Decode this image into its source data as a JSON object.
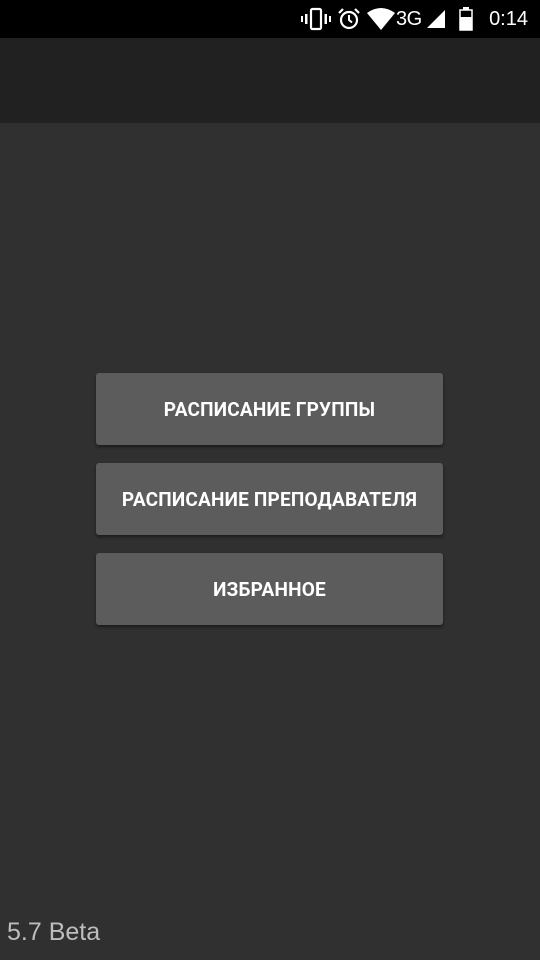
{
  "status_bar": {
    "time": "0:14",
    "network_type": "3G",
    "icons": [
      "vibrate-icon",
      "alarm-icon",
      "wifi-icon",
      "cell-signal-icon",
      "battery-icon"
    ]
  },
  "menu": {
    "group_schedule_label": "РАСПИСАНИЕ ГРУППЫ",
    "teacher_schedule_label": "РАСПИСАНИЕ ПРЕПОДАВАТЕЛЯ",
    "favorites_label": "ИЗБРАННОЕ"
  },
  "footer": {
    "version": "5.7 Beta"
  },
  "colors": {
    "background": "#303030",
    "app_bar": "#212121",
    "status_bar": "#000000",
    "button": "#5c5c5d",
    "button_text": "#ffffff",
    "version_text": "#bdbdbd"
  }
}
